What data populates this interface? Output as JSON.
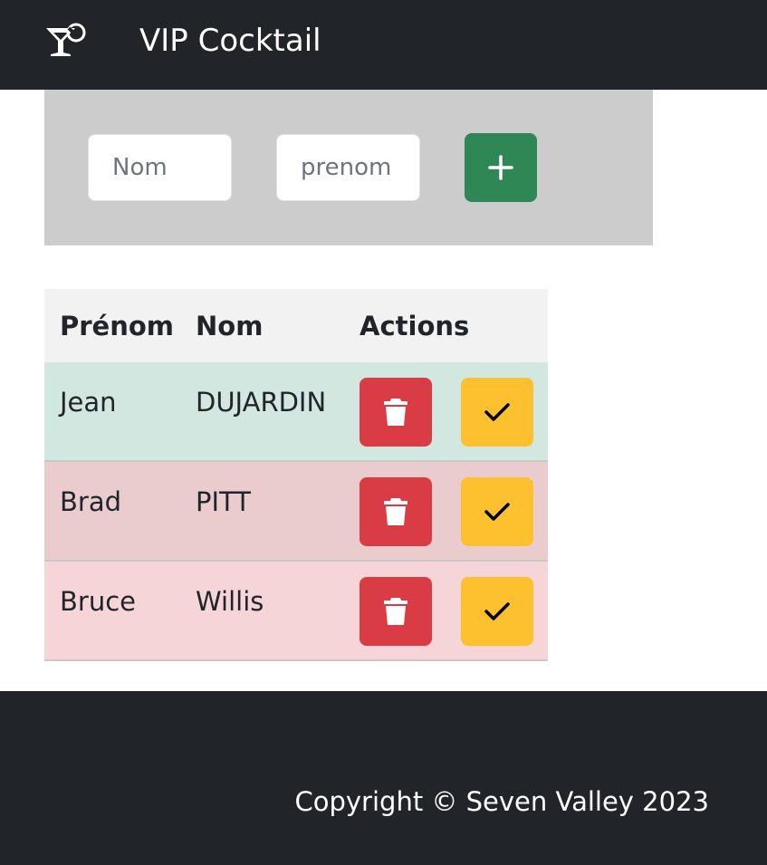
{
  "navbar": {
    "brand_icon": "cocktail-glass-icon",
    "title": "VIP Cocktail"
  },
  "form": {
    "nom_placeholder": "Nom",
    "prenom_placeholder": "prenom",
    "add_icon": "plus-icon"
  },
  "table": {
    "headers": {
      "prenom": "Prénom",
      "nom": "Nom",
      "actions": "Actions"
    },
    "rows": [
      {
        "prenom": "Jean",
        "nom": "DUJARDIN",
        "row_color": "#d2e7df"
      },
      {
        "prenom": "Brad",
        "nom": "PITT",
        "row_color": "#eacccf"
      },
      {
        "prenom": "Bruce",
        "nom": "Willis",
        "row_color": "#f6d5d9"
      }
    ],
    "delete_icon": "trash-icon",
    "confirm_icon": "check-icon"
  },
  "footer": {
    "copyright": "Copyright © Seven Valley 2023"
  },
  "colors": {
    "dark": "#212529",
    "panel": "#cccccc",
    "success": "#2e8754",
    "danger": "#d93c44",
    "warning": "#fdc02e"
  }
}
